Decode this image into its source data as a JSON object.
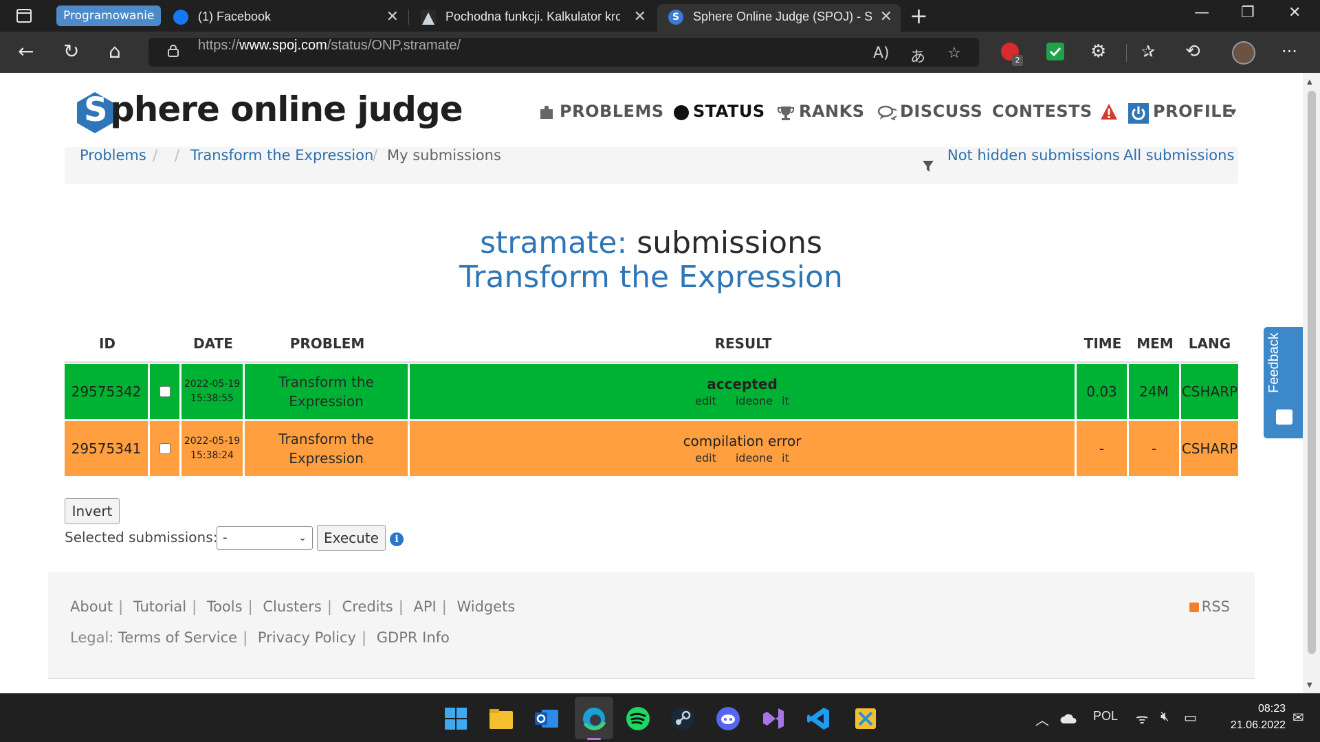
{
  "browser": {
    "tab_group": "Programowanie",
    "tabs": [
      {
        "title": "(1) Facebook"
      },
      {
        "title": "Pochodna funkcji. Kalkulator krok"
      },
      {
        "title": "Sphere Online Judge (SPOJ) - Sta"
      }
    ],
    "url_prefix": "https://",
    "url_domain": "www.spoj.com",
    "url_path": "/status/ONP,stramate/",
    "extension_badge": "2"
  },
  "site": {
    "logo_letter": "S",
    "logo_text": "phere online judge",
    "nav": {
      "problems": "PROBLEMS",
      "status": "STATUS",
      "ranks": "RANKS",
      "discuss": "DISCUSS",
      "contests": "CONTESTS",
      "profile": "PROFILE"
    }
  },
  "breadcrumb": {
    "problems": "Problems",
    "problem": "Transform the Expression",
    "current": "My submissions",
    "filter_not_hidden": "Not hidden submissions",
    "filter_all": "All submissions"
  },
  "heading": {
    "user": "stramate:",
    "suffix": "submissions",
    "problem": "Transform the Expression"
  },
  "table": {
    "headers": {
      "id": "ID",
      "date": "DATE",
      "problem": "PROBLEM",
      "result": "RESULT",
      "time": "TIME",
      "mem": "MEM",
      "lang": "LANG"
    },
    "rows": [
      {
        "id": "29575342",
        "date": "2022-05-19",
        "time_of_day": "15:38:55",
        "problem_l1": "Transform the",
        "problem_l2": "Expression",
        "result": "accepted",
        "edit": "edit",
        "ideone": "ideone it",
        "time": "0.03",
        "mem": "24M",
        "lang": "CSHARP",
        "status_color": "#00b233"
      },
      {
        "id": "29575341",
        "date": "2022-05-19",
        "time_of_day": "15:38:24",
        "problem_l1": "Transform the",
        "problem_l2": "Expression",
        "result": "compilation error",
        "edit": "edit",
        "ideone": "ideone it",
        "time": "-",
        "mem": "-",
        "lang": "CSHARP",
        "status_color": "#ff9f40"
      }
    ]
  },
  "actions": {
    "invert": "Invert",
    "selected_label": "Selected submissions:",
    "selected_value": "-",
    "execute": "Execute"
  },
  "footer": {
    "links": [
      "About",
      "Tutorial",
      "Tools",
      "Clusters",
      "Credits",
      "API",
      "Widgets"
    ],
    "legal_prefix": "Legal:",
    "legal": [
      "Terms of Service",
      "Privacy Policy",
      "GDPR Info"
    ],
    "rss": "RSS"
  },
  "feedback": "Feedback",
  "taskbar": {
    "lang": "POL",
    "time": "08:23",
    "date": "21.06.2022"
  },
  "icons": [
    "tab-actions-icon",
    "facebook-icon",
    "calculator-icon",
    "spoj-icon",
    "back-icon",
    "refresh-icon",
    "home-icon",
    "lock-icon",
    "read-aloud-icon",
    "translate-icon",
    "favorite-add-icon",
    "extension-icon",
    "favorites-icon",
    "history-icon",
    "more-icon",
    "puzzle-icon",
    "circle-icon",
    "trophy-icon",
    "chat-icon",
    "warning-icon",
    "power-icon",
    "filter-icon",
    "info-icon",
    "rss-icon"
  ]
}
